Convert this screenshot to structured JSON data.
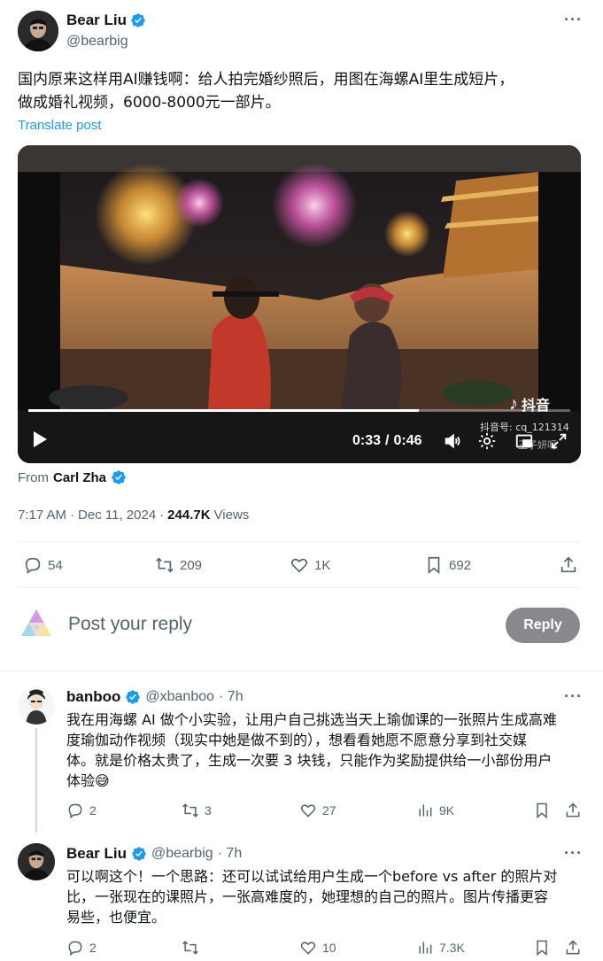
{
  "tweet": {
    "author_name": "Bear Liu",
    "author_handle": "@bearbig",
    "text_line1": "国内原来这样用AI赚钱啊：给人拍完婚纱照后，用图在海螺AI里生成短片，",
    "text_line2": "做成婚礼视频，6000-8000元一部片。",
    "translate": "Translate post",
    "video": {
      "current_time": "0:33",
      "separator": "/",
      "duration": "0:46",
      "progress": 0.72,
      "watermark_brand": "抖音",
      "watermark_id": "抖音号: cq_121314",
      "watermark_user": "王子妍呀"
    },
    "source_prefix": "From",
    "source_name": "Carl Zha",
    "time": "7:17 AM",
    "dot": "·",
    "date": "Dec 11, 2024",
    "views_count": "244.7K",
    "views_label": "Views",
    "actions": {
      "replies": "54",
      "reposts": "209",
      "likes": "1K",
      "bookmarks": "692"
    }
  },
  "composer": {
    "placeholder": "Post your reply",
    "button": "Reply"
  },
  "replies": [
    {
      "name": "banboo",
      "handle": "@xbanboo",
      "age": "· 7h",
      "line1": "我在用海螺 AI 做个小实验，让用户自己挑选当天上瑜伽课的一张照片生成高难",
      "line2": "度瑜伽动作视频（现实中她是做不到的），想看看她愿不愿意分享到社交媒",
      "line3": "体。就是价格太贵了，生成一次要 3 块钱，只能作为奖励提供给一小部份用户",
      "line4": "体验😅",
      "replies": "2",
      "reposts": "3",
      "likes": "27",
      "views": "9K"
    },
    {
      "name": "Bear Liu",
      "handle": "@bearbig",
      "age": "· 7h",
      "line1": "可以啊这个！一个思路：还可以试试给用户生成一个before vs after 的照片对",
      "line2": "比，一张现在的课照片，一张高难度的，她理想的自己的照片。图片传播更容",
      "line3": "易些，也便宜。",
      "replies": "2",
      "reposts": "",
      "likes": "10",
      "views": "7.3K"
    }
  ],
  "colors": {
    "accent": "#1d9bf0",
    "text": "#0f1419",
    "secondary": "#536471",
    "reply_button": "#87898c"
  }
}
